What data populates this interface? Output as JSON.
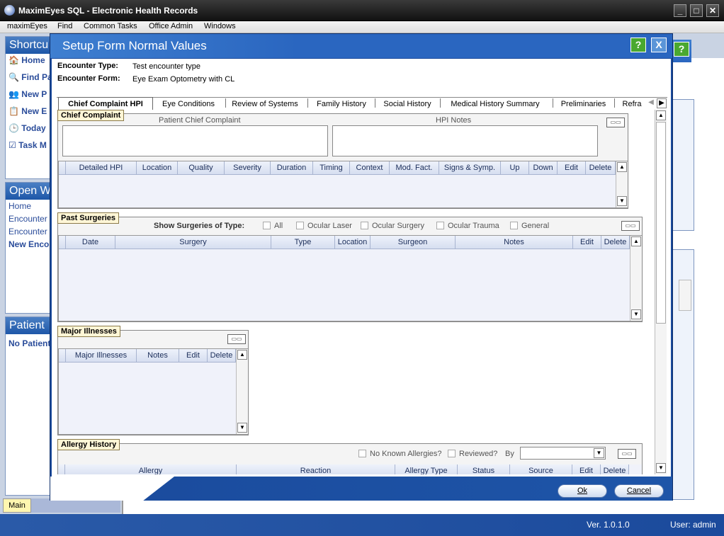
{
  "window": {
    "title": "MaximEyes SQL - Electronic Health Records"
  },
  "menu": [
    "maximEyes",
    "Find",
    "Common Tasks",
    "Office Admin",
    "Windows"
  ],
  "left": {
    "shortcuts_title": "Shortcu",
    "shortcuts": [
      "Home",
      "Find Pa",
      "New P",
      "New E",
      "Today",
      "Task M"
    ],
    "open_title": "Open W",
    "open_items": [
      "Home",
      "Encounter",
      "Encounter",
      "New Encou"
    ],
    "patient_title": "Patient",
    "patient_text": "No Patient",
    "main_tab": "Main"
  },
  "dialog": {
    "title": "Setup Form Normal Values",
    "help": "?",
    "close": "X",
    "encounter_type_label": "Encounter Type:",
    "encounter_type_value": "Test encounter type",
    "encounter_form_label": "Encounter Form:",
    "encounter_form_value": "Eye Exam Optometry with CL",
    "tabs": [
      "Chief Complaint HPI",
      "Eye Conditions",
      "Review of Systems",
      "Family History",
      "Social History",
      "Medical History Summary",
      "Preliminaries",
      "Refra"
    ],
    "ok": "Ok",
    "cancel": "Cancel"
  },
  "chief": {
    "label": "Chief Complaint",
    "patient_cc": "Patient Chief Complaint",
    "hpi_notes": "HPI Notes",
    "columns": [
      "Detailed HPI",
      "Location",
      "Quality",
      "Severity",
      "Duration",
      "Timing",
      "Context",
      "Mod. Fact.",
      "Signs & Symp.",
      "Up",
      "Down",
      "Edit",
      "Delete"
    ]
  },
  "surgeries": {
    "label": "Past Surgeries",
    "filter_label": "Show Surgeries of Type:",
    "types": [
      "All",
      "Ocular Laser",
      "Ocular Surgery",
      "Ocular Trauma",
      "General"
    ],
    "columns": [
      "Date",
      "Surgery",
      "Type",
      "Location",
      "Surgeon",
      "Notes",
      "Edit",
      "Delete"
    ]
  },
  "illnesses": {
    "label": "Major Illnesses",
    "columns": [
      "Major Illnesses",
      "Notes",
      "Edit",
      "Delete"
    ]
  },
  "allergy": {
    "label": "Allergy History",
    "nka": "No Known Allergies?",
    "reviewed": "Reviewed?",
    "by": "By",
    "columns": [
      "Allergy",
      "Reaction",
      "Allergy Type",
      "Status",
      "Source",
      "Edit",
      "Delete"
    ]
  },
  "status": {
    "version": "Ver. 1.0.1.0",
    "user": "User: admin"
  }
}
